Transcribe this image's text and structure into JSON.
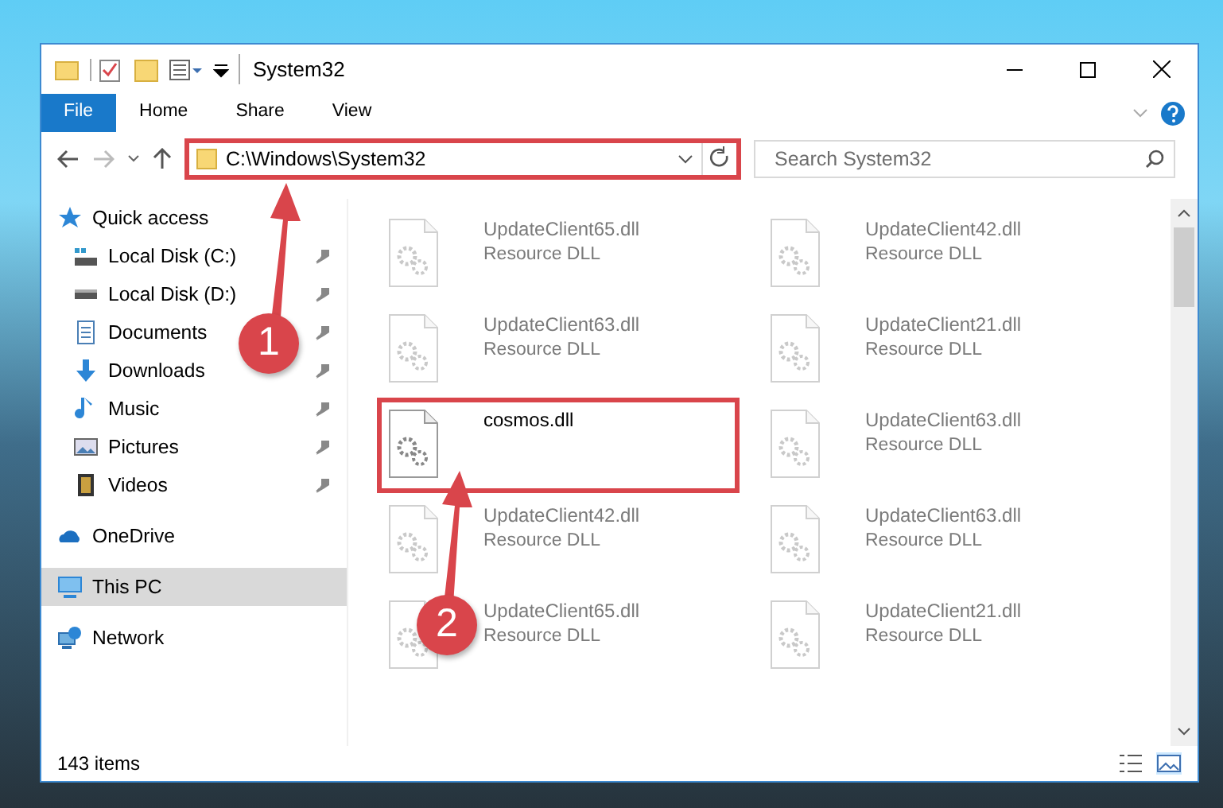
{
  "window": {
    "title": "System32"
  },
  "tabs": [
    {
      "label": "File",
      "kind": "file-menu",
      "selected": false
    },
    {
      "label": "Home",
      "kind": "tab",
      "selected": false
    },
    {
      "label": "Share",
      "kind": "tab",
      "selected": false
    },
    {
      "label": "View",
      "kind": "tab",
      "selected": false
    }
  ],
  "address": {
    "path": "C:\\Windows\\System32",
    "highlighted": true
  },
  "search": {
    "placeholder": "Search System32"
  },
  "sidebar": {
    "items": [
      {
        "label": "Quick access",
        "kind": "star",
        "selected": false,
        "children": [
          {
            "label": "Local Disk (C:)",
            "kind": "drive-c",
            "selected": false,
            "pinned": true
          },
          {
            "label": "Local Disk (D:)",
            "kind": "drive",
            "selected": false,
            "pinned": true
          },
          {
            "label": "Documents",
            "kind": "document",
            "selected": false,
            "pinned": true
          },
          {
            "label": "Downloads",
            "kind": "download",
            "selected": false,
            "pinned": true
          },
          {
            "label": "Music",
            "kind": "music",
            "selected": false,
            "pinned": true
          },
          {
            "label": "Pictures",
            "kind": "picture",
            "selected": false,
            "pinned": true
          },
          {
            "label": "Videos",
            "kind": "video",
            "selected": false,
            "pinned": true
          }
        ]
      },
      {
        "label": "OneDrive",
        "kind": "cloud",
        "selected": false
      },
      {
        "label": "This PC",
        "kind": "computer",
        "selected": true
      },
      {
        "label": "Network",
        "kind": "network",
        "selected": false
      }
    ]
  },
  "files": [
    {
      "name": "UpdateClient65.dll",
      "type": "Resource DLL",
      "highlighted": false,
      "faded": true
    },
    {
      "name": "UpdateClient42.dll",
      "type": "Resource DLL",
      "highlighted": false,
      "faded": true
    },
    {
      "name": "UpdateClient63.dll",
      "type": "Resource DLL",
      "highlighted": false,
      "faded": true
    },
    {
      "name": "UpdateClient21.dll",
      "type": "Resource DLL",
      "highlighted": false,
      "faded": true
    },
    {
      "name": "cosmos.dll",
      "highlighted": true,
      "faded": false
    },
    {
      "name": "UpdateClient63.dll",
      "type": "Resource DLL",
      "highlighted": false,
      "faded": true
    },
    {
      "name": "UpdateClient42.dll",
      "type": "Resource DLL",
      "highlighted": false,
      "faded": true
    },
    {
      "name": "UpdateClient63.dll",
      "type": "Resource DLL",
      "highlighted": false,
      "faded": true
    },
    {
      "name": "UpdateClient65.dll",
      "type": "Resource DLL",
      "highlighted": false,
      "faded": true
    },
    {
      "name": "UpdateClient21.dll",
      "type": "Resource DLL",
      "highlighted": false,
      "faded": true
    }
  ],
  "callouts": [
    {
      "number": "1"
    },
    {
      "number": "2"
    }
  ],
  "status_bar": {
    "item_count": "143 items"
  }
}
